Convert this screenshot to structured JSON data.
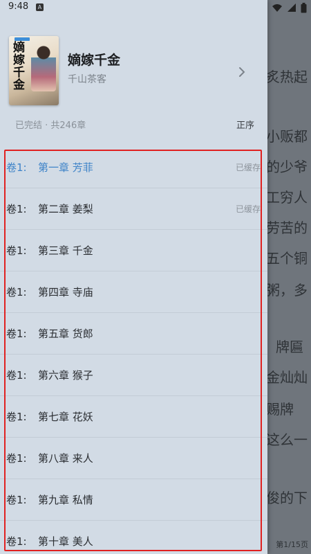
{
  "status_bar": {
    "time": "9:48",
    "notif_letter": "A"
  },
  "reader": {
    "lines": [
      "炙热起",
      "小贩都",
      "的少爷",
      "工穷人",
      "劳苦的",
      "五个铜",
      "粥，多",
      "牌匾",
      "金灿灿",
      "赐牌",
      "这么一",
      "俊的下"
    ],
    "page_indicator": "第1/15页"
  },
  "book": {
    "title": "嫡嫁千金",
    "author": "千山茶客",
    "cover_title": "嫡嫁千金",
    "meta": "已完结 · 共246章",
    "sort_label": "正序"
  },
  "chapters": [
    {
      "volume": "卷1:",
      "name": "第一章 芳菲",
      "cached": "已缓存",
      "active": true
    },
    {
      "volume": "卷1:",
      "name": "第二章 姜梨",
      "cached": "已缓存",
      "active": false
    },
    {
      "volume": "卷1:",
      "name": "第三章 千金",
      "cached": "",
      "active": false
    },
    {
      "volume": "卷1:",
      "name": "第四章 寺庙",
      "cached": "",
      "active": false
    },
    {
      "volume": "卷1:",
      "name": "第五章 货郎",
      "cached": "",
      "active": false
    },
    {
      "volume": "卷1:",
      "name": "第六章 猴子",
      "cached": "",
      "active": false
    },
    {
      "volume": "卷1:",
      "name": "第七章 花妖",
      "cached": "",
      "active": false
    },
    {
      "volume": "卷1:",
      "name": "第八章 来人",
      "cached": "",
      "active": false
    },
    {
      "volume": "卷1:",
      "name": "第九章 私情",
      "cached": "",
      "active": false
    },
    {
      "volume": "卷1:",
      "name": "第十章 美人",
      "cached": "",
      "active": false
    }
  ],
  "colors": {
    "accent": "#3e83c8",
    "highlight": "#e02020",
    "drawer_bg": "#d2dbe5"
  }
}
